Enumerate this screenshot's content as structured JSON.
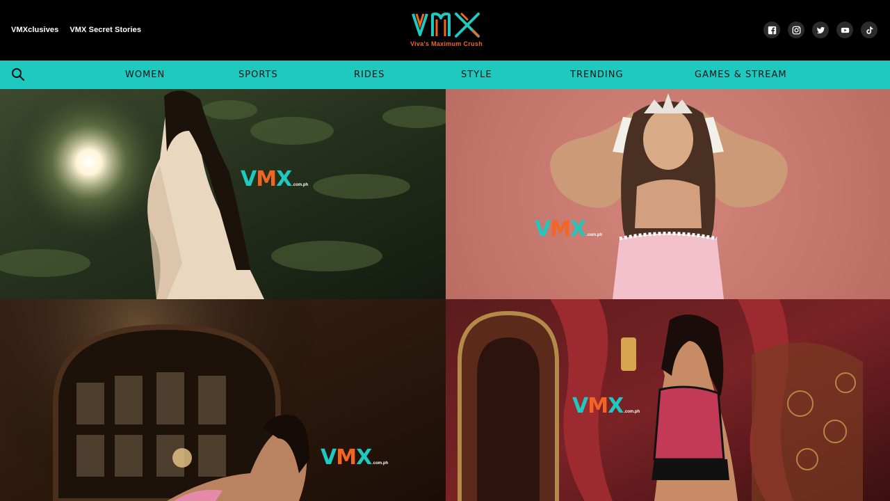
{
  "header": {
    "links": [
      "VMXclusives",
      "VMX Secret Stories"
    ],
    "logo_text": "VMX",
    "tagline": "Viva's Maximum Crush",
    "socials": [
      "facebook-icon",
      "instagram-icon",
      "twitter-icon",
      "youtube-icon",
      "tiktok-icon"
    ]
  },
  "nav": {
    "items": [
      "WOMEN",
      "SPORTS",
      "RIDES",
      "STYLE",
      "TRENDING",
      "GAMES & STREAM"
    ]
  },
  "grid": {
    "watermark": {
      "letters": [
        "V",
        "M",
        "X"
      ],
      "suffix": ".com.ph"
    }
  },
  "colors": {
    "accent_teal": "#1fc9bf",
    "accent_orange": "#f26522",
    "header_bg": "#000000"
  }
}
